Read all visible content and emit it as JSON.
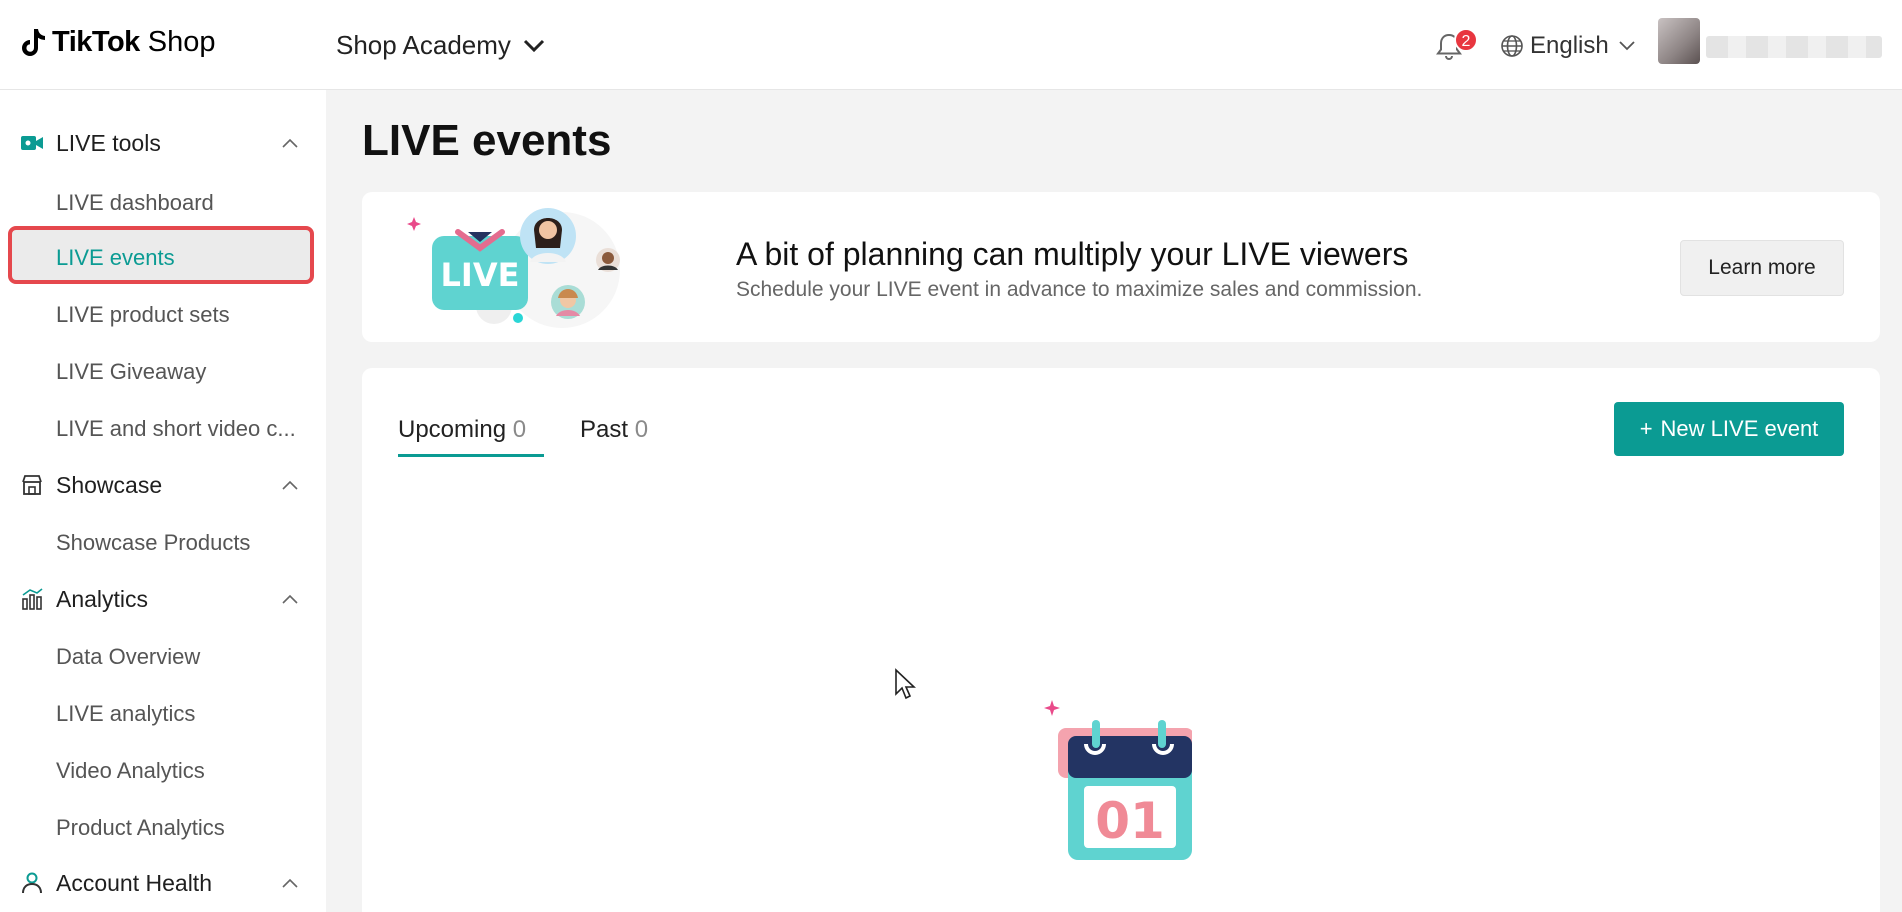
{
  "header": {
    "logo_brand": "TikTok",
    "logo_suffix": "Shop",
    "academy_label": "Shop Academy",
    "notification_count": "2",
    "language": "English"
  },
  "sidebar": {
    "sections": [
      {
        "label": "LIVE tools",
        "icon": "video-camera-icon",
        "items": [
          "LIVE dashboard",
          "LIVE events",
          "LIVE product sets",
          "LIVE Giveaway",
          "LIVE and short video c..."
        ]
      },
      {
        "label": "Showcase",
        "icon": "storefront-icon",
        "items": [
          "Showcase Products"
        ]
      },
      {
        "label": "Analytics",
        "icon": "bar-chart-icon",
        "items": [
          "Data Overview",
          "LIVE analytics",
          "Video Analytics",
          "Product Analytics"
        ]
      },
      {
        "label": "Account Health",
        "icon": "person-icon",
        "items": []
      }
    ],
    "active_item": "LIVE events"
  },
  "main": {
    "title": "LIVE events",
    "banner": {
      "badge_text": "LIVE",
      "title": "A bit of planning can multiply your LIVE viewers",
      "subtitle": "Schedule your LIVE event in advance to maximize sales and commission.",
      "button": "Learn more"
    },
    "tabs": [
      {
        "label": "Upcoming",
        "count": "0",
        "active": true
      },
      {
        "label": "Past",
        "count": "0",
        "active": false
      }
    ],
    "new_button": "New LIVE event",
    "new_button_icon": "+",
    "empty_calendar_text": "01"
  },
  "colors": {
    "accent": "#0b9b93",
    "highlight_border": "#e5484d",
    "badge": "#e8363f"
  }
}
